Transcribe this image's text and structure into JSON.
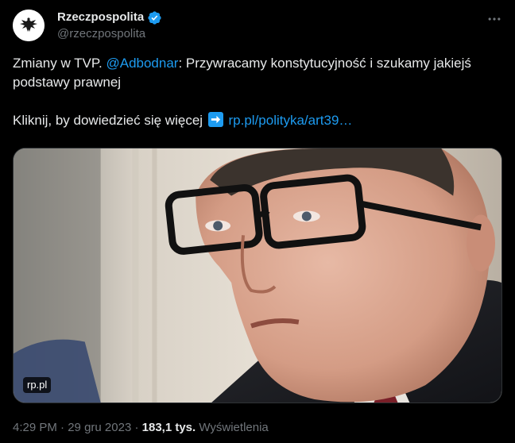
{
  "author": {
    "display_name": "Rzeczpospolita",
    "handle": "@rzeczpospolita",
    "verified": true,
    "avatar_icon": "eagle-logo-icon"
  },
  "tweet": {
    "line1_prefix": "Zmiany w TVP. ",
    "line1_mention": "@Adbodnar",
    "line1_suffix": ": Przywracamy konstytucyjność i szukamy jakiejś podstawy prawnej",
    "line2_prefix": "Kliknij, by dowiedzieć się więcej ",
    "line2_emoji": "right-arrow-emoji",
    "line2_link": "rp.pl/polityka/art39…"
  },
  "media": {
    "domain": "rp.pl",
    "description": "photo"
  },
  "meta": {
    "time": "4:29 PM",
    "separator1": " · ",
    "date": "29 gru 2023",
    "separator2": " · ",
    "views_count": "183,1 tys.",
    "views_label": " Wyświetlenia"
  },
  "colors": {
    "background": "#000000",
    "text": "#e7e9ea",
    "muted": "#71767b",
    "accent": "#1d9bf0"
  }
}
